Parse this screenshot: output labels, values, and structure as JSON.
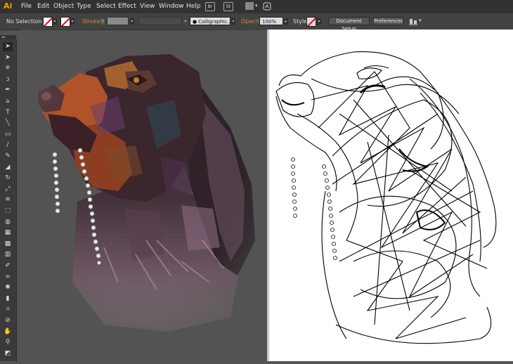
{
  "app": {
    "logo": "Ai"
  },
  "menu": {
    "items": [
      "File",
      "Edit",
      "Object",
      "Type",
      "Select",
      "Effect",
      "View",
      "Window",
      "Help"
    ]
  },
  "bridge_icons": [
    "Br",
    "St"
  ],
  "control_bar": {
    "selection": "No Selection",
    "stroke_label": "Stroke",
    "font_value": "Calligraphic...",
    "opacity_label": "Opacity",
    "opacity_value": "100%",
    "style_label": "Style",
    "document_setup": "Document Setup",
    "preferences": "Preferences"
  },
  "tools": [
    "selection-tool",
    "direct-selection-tool",
    "magic-wand-tool",
    "lasso-tool",
    "pen-tool",
    "curvature-tool",
    "type-tool",
    "line-segment-tool",
    "rectangle-tool",
    "paintbrush-tool",
    "pencil-tool",
    "eraser-tool",
    "rotate-tool",
    "scale-tool",
    "width-tool",
    "free-transform-tool",
    "shape-builder-tool",
    "perspective-grid-tool",
    "mesh-tool",
    "gradient-tool",
    "eyedropper-tool",
    "blend-tool",
    "symbol-sprayer-tool",
    "column-graph-tool",
    "artboard-tool",
    "slice-tool",
    "hand-tool",
    "zoom-tool",
    "fill-stroke-swatch"
  ],
  "colors": {
    "accent": "#ff9a00",
    "stroke_label": "#d98a2a",
    "none_slash": "#e0001a"
  }
}
